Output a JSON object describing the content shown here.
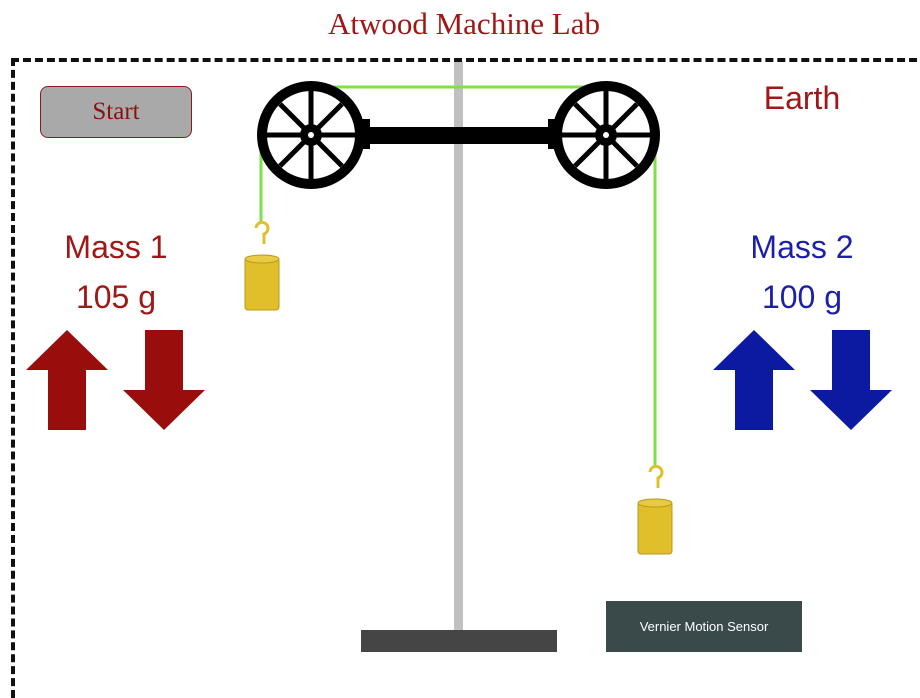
{
  "page": {
    "title": "Atwood Machine Lab"
  },
  "controls": {
    "start_label": "Start"
  },
  "environment": {
    "planet": "Earth"
  },
  "mass1": {
    "label": "Mass 1",
    "value": "105 g",
    "color": "#a01717",
    "up_icon": "arrow-up-icon",
    "down_icon": "arrow-down-icon"
  },
  "mass2": {
    "label": "Mass 2",
    "value": "100 g",
    "color": "#0b1aa0",
    "up_icon": "arrow-up-icon",
    "down_icon": "arrow-down-icon"
  },
  "sensor": {
    "label": "Vernier Motion Sensor"
  },
  "colors": {
    "rope": "#7ee04a",
    "weight": "#e0bf2a",
    "stand": "#c0c0c0",
    "pulley": "#000000",
    "base": "#454545"
  }
}
